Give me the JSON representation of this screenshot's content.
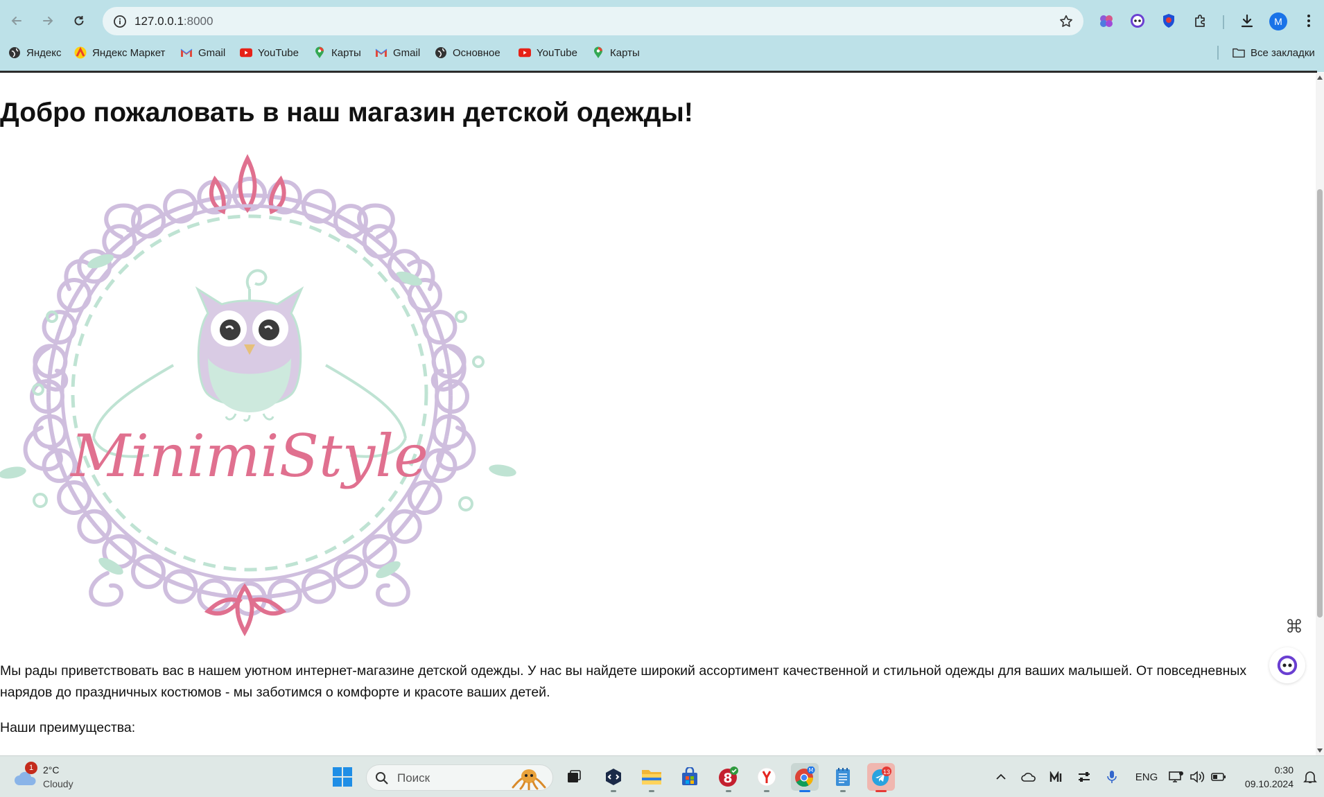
{
  "browser": {
    "url_host": "127.0.0.1",
    "url_port": ":8000",
    "avatar_letter": "M",
    "bookmarks": [
      {
        "label": "Яндекс",
        "icon": "globe-icon"
      },
      {
        "label": "Яндекс Маркет",
        "icon": "yandex-market-icon"
      },
      {
        "label": "Gmail",
        "icon": "gmail-icon"
      },
      {
        "label": "YouTube",
        "icon": "youtube-icon"
      },
      {
        "label": "Карты",
        "icon": "maps-pin-icon"
      },
      {
        "label": "Gmail",
        "icon": "gmail-icon"
      },
      {
        "label": "Основное",
        "icon": "globe-icon"
      },
      {
        "label": "YouTube",
        "icon": "youtube-icon"
      },
      {
        "label": "Карты",
        "icon": "maps-pin-icon"
      }
    ],
    "all_bookmarks": "Все закладки"
  },
  "page": {
    "title": "Добро пожаловать в наш магазин детской одежды!",
    "logo_text": "MinimiStyle",
    "intro": "Мы рады приветствовать вас в нашем уютном интернет-магазине детской одежды. У нас вы найдете широкий ассортимент качественной и стильной одежды для ваших малышей. От повседневных нарядов до праздничных костюмов - мы заботимся о комфорте и красоте ваших детей.",
    "advantages_heading": "Наши преимущества:"
  },
  "taskbar": {
    "weather_temp": "2°C",
    "weather_cond": "Cloudy",
    "weather_badge": "1",
    "search_placeholder": "Поиск",
    "telegram_badge": "13",
    "language": "ENG",
    "time": "0:30",
    "date": "09.10.2024"
  },
  "colors": {
    "chrome_bg": "#bde1e8",
    "logo_pink": "#e0708f",
    "logo_lilac": "#cfbede",
    "logo_mint": "#bfe3d3"
  }
}
